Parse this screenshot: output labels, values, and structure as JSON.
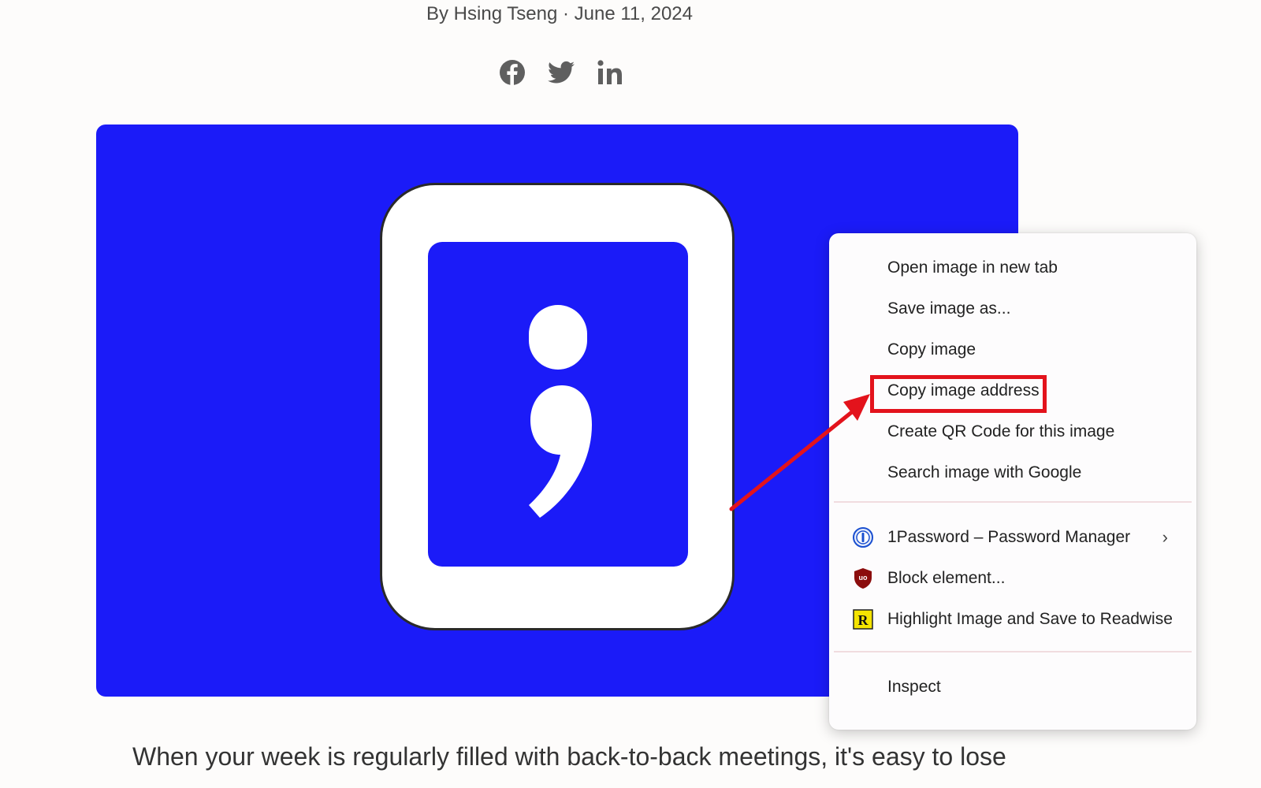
{
  "article": {
    "byline": "By Hsing Tseng · June 11, 2024",
    "body_text": "When your week is regularly filled with back-to-back meetings, it's easy to lose"
  },
  "share_icons": [
    "facebook-icon",
    "twitter-icon",
    "linkedin-icon"
  ],
  "hero": {
    "background_color": "#1b1bf8",
    "glyph": ";"
  },
  "context_menu": {
    "items": [
      {
        "label": "Open image in new tab"
      },
      {
        "label": "Save image as..."
      },
      {
        "label": "Copy image"
      },
      {
        "label": "Copy image address"
      },
      {
        "label": "Create QR Code for this image"
      },
      {
        "label": "Search image with Google"
      },
      {
        "label": "1Password – Password Manager",
        "icon": "1password-icon",
        "submenu": true
      },
      {
        "label": "Block element...",
        "icon": "ublock-icon"
      },
      {
        "label": "Highlight Image and Save to Readwise",
        "icon": "readwise-icon"
      },
      {
        "label": "Inspect"
      }
    ]
  },
  "annotation": {
    "highlight_color": "#e3131c"
  }
}
